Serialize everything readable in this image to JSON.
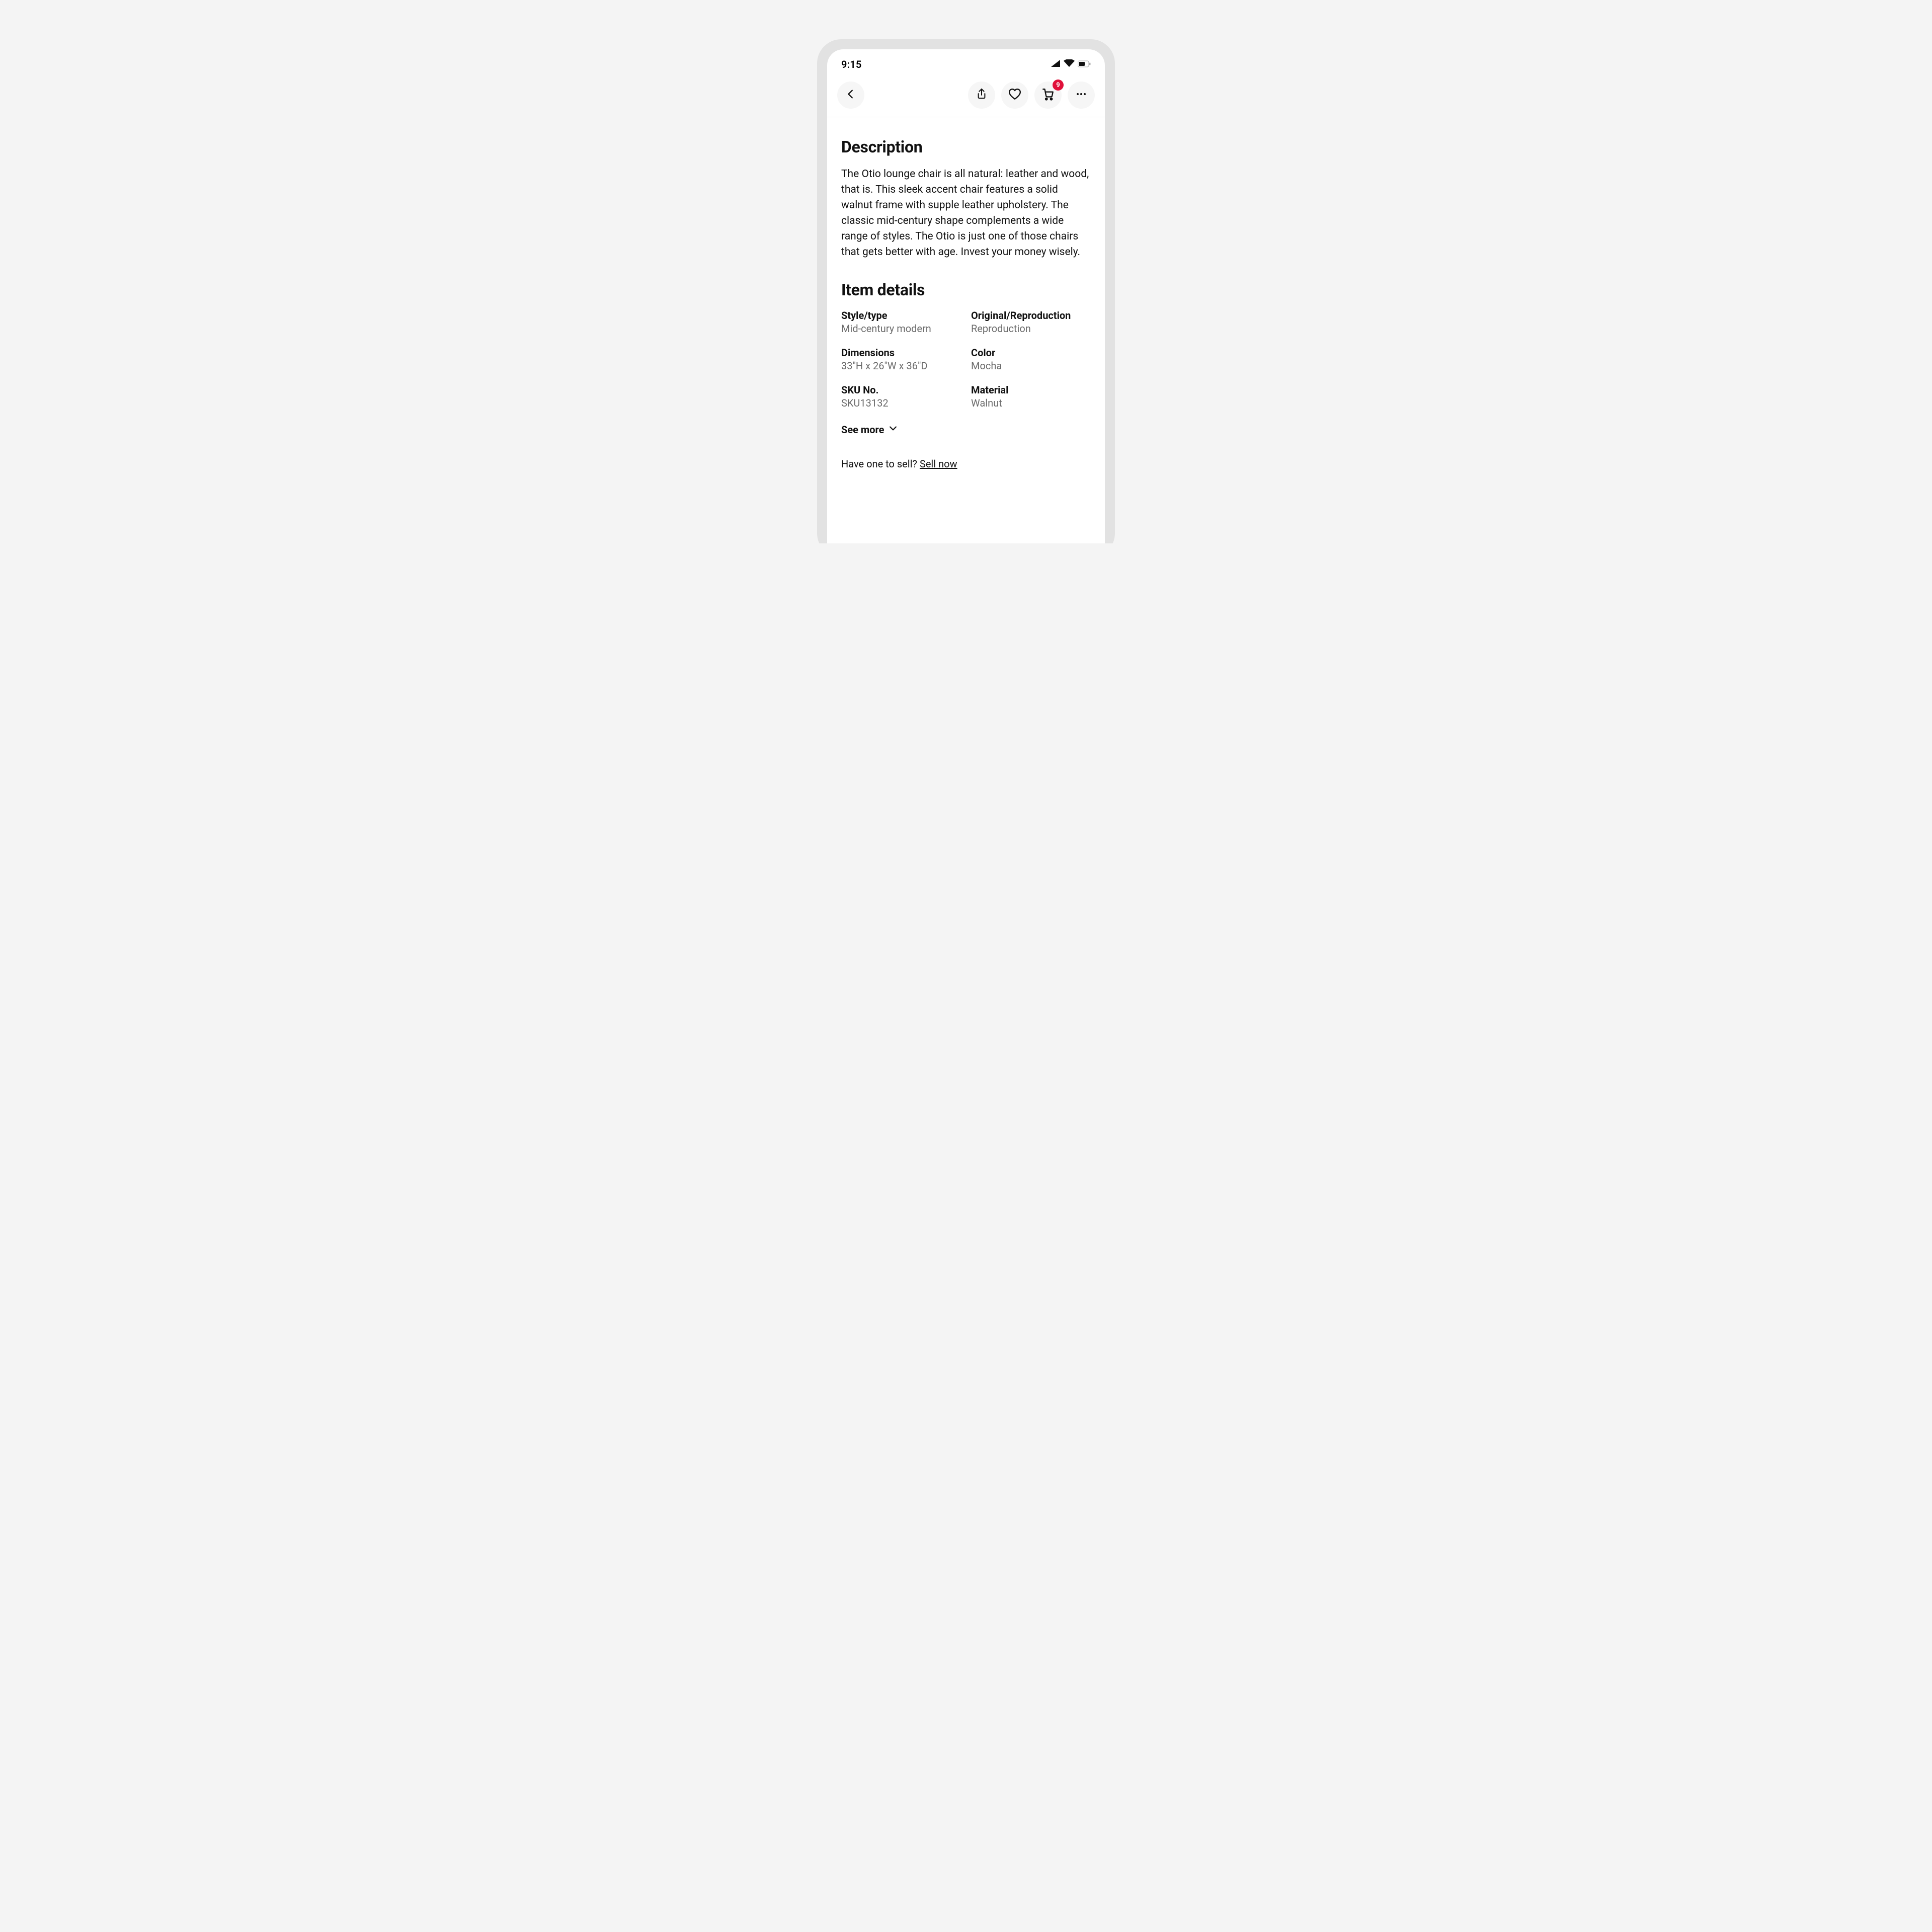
{
  "status": {
    "time": "9:15"
  },
  "header": {
    "cart_badge": "9"
  },
  "description": {
    "heading": "Description",
    "body": "The Otio lounge chair is all natural: leather and wood, that is. This sleek accent chair features a solid walnut frame with supple leather upholstery. The classic mid-century shape complements a wide range of styles. The Otio is just one of those chairs that gets better with age. Invest your money wisely."
  },
  "item_details": {
    "heading": "Item details",
    "rows": [
      {
        "label": "Style/type",
        "value": "Mid-century modern"
      },
      {
        "label": "Original/Reproduction",
        "value": "Reproduction"
      },
      {
        "label": "Dimensions",
        "value": "33\"H x 26\"W x 36\"D"
      },
      {
        "label": "Color",
        "value": "Mocha"
      },
      {
        "label": "SKU No.",
        "value": "SKU13132"
      },
      {
        "label": "Material",
        "value": "Walnut"
      }
    ],
    "see_more": "See more"
  },
  "sell": {
    "prompt": "Have one to sell? ",
    "link": "Sell now"
  }
}
